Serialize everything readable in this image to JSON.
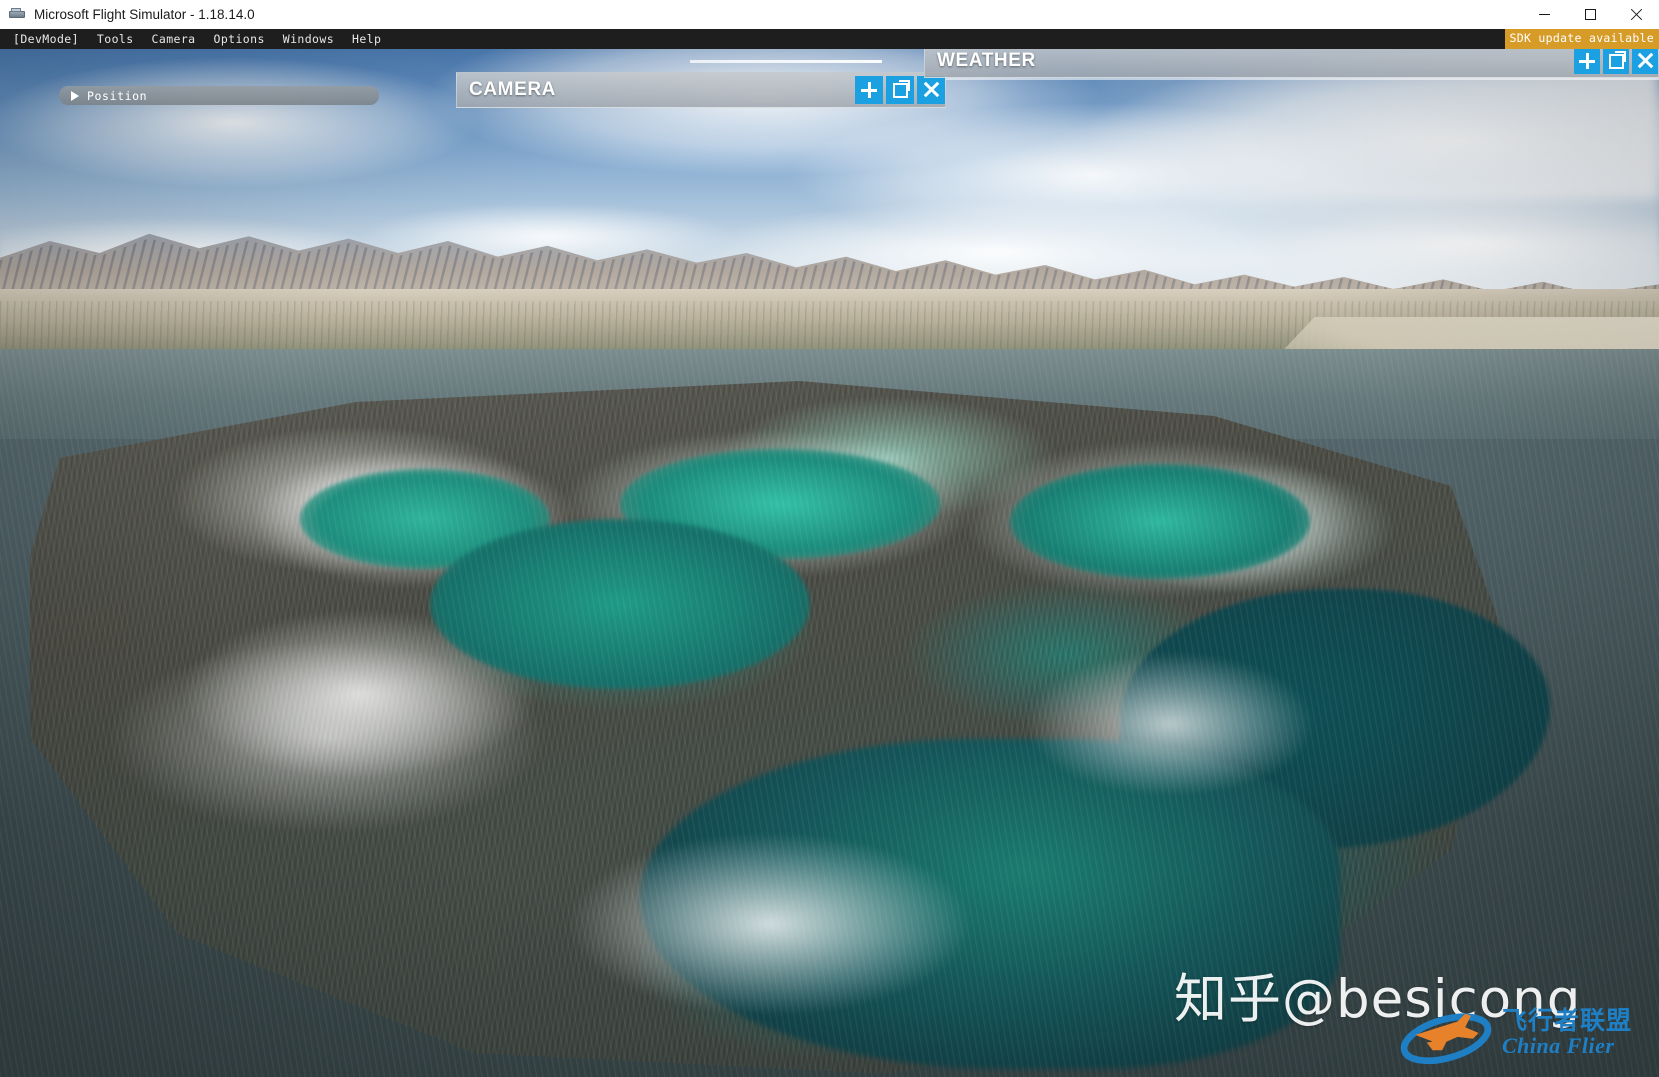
{
  "window": {
    "title": "Microsoft Flight Simulator - 1.18.14.0",
    "icon": "flight-simulator-icon",
    "controls": {
      "minimize": "minimize-icon",
      "maximize": "maximize-icon",
      "close": "close-icon"
    }
  },
  "menubar": {
    "items": [
      {
        "label": "[DevMode]"
      },
      {
        "label": "Tools"
      },
      {
        "label": "Camera"
      },
      {
        "label": "Options"
      },
      {
        "label": "Windows"
      },
      {
        "label": "Help"
      }
    ],
    "notice": {
      "label": "SDK update available",
      "background": "#d79b28",
      "color": "#ffffff"
    }
  },
  "panels": {
    "position": {
      "title": "Position",
      "collapsed": true,
      "expander_icon": "triangle-right-icon"
    },
    "camera": {
      "title": "CAMERA",
      "buttons": [
        {
          "name": "add-button",
          "icon": "plus-icon"
        },
        {
          "name": "popout-button",
          "icon": "pop-out-icon"
        },
        {
          "name": "close-button",
          "icon": "close-icon"
        }
      ]
    },
    "weather": {
      "title": "WEATHER",
      "buttons": [
        {
          "name": "add-button",
          "icon": "plus-icon"
        },
        {
          "name": "popout-button",
          "icon": "pop-out-icon"
        },
        {
          "name": "close-button",
          "icon": "close-icon"
        }
      ]
    }
  },
  "theme": {
    "accent": "#1ba1e2",
    "panel_header": "#b4babf",
    "menubar_bg": "#1e1e1e",
    "titlebar_bg": "#ffffff",
    "notice_bg": "#d79b28"
  },
  "scene": {
    "description": "Aerial view of a turquoise salt lagoon and mud flats with arid snow-capped mountain range on the horizon",
    "sky_color": "#4e7fb8",
    "water_color": "#3c4b4e",
    "lagoon_color": "#17907f",
    "salt_crust_color": "#ffffff",
    "mountain_color": "#cbbda9"
  },
  "watermarks": {
    "zhihu": "知乎@besicong",
    "flier_cn": "飞行者联盟",
    "flier_en": "China Flier",
    "flier_color": "#1f7fc4",
    "flier_accent": "#e8822a"
  }
}
